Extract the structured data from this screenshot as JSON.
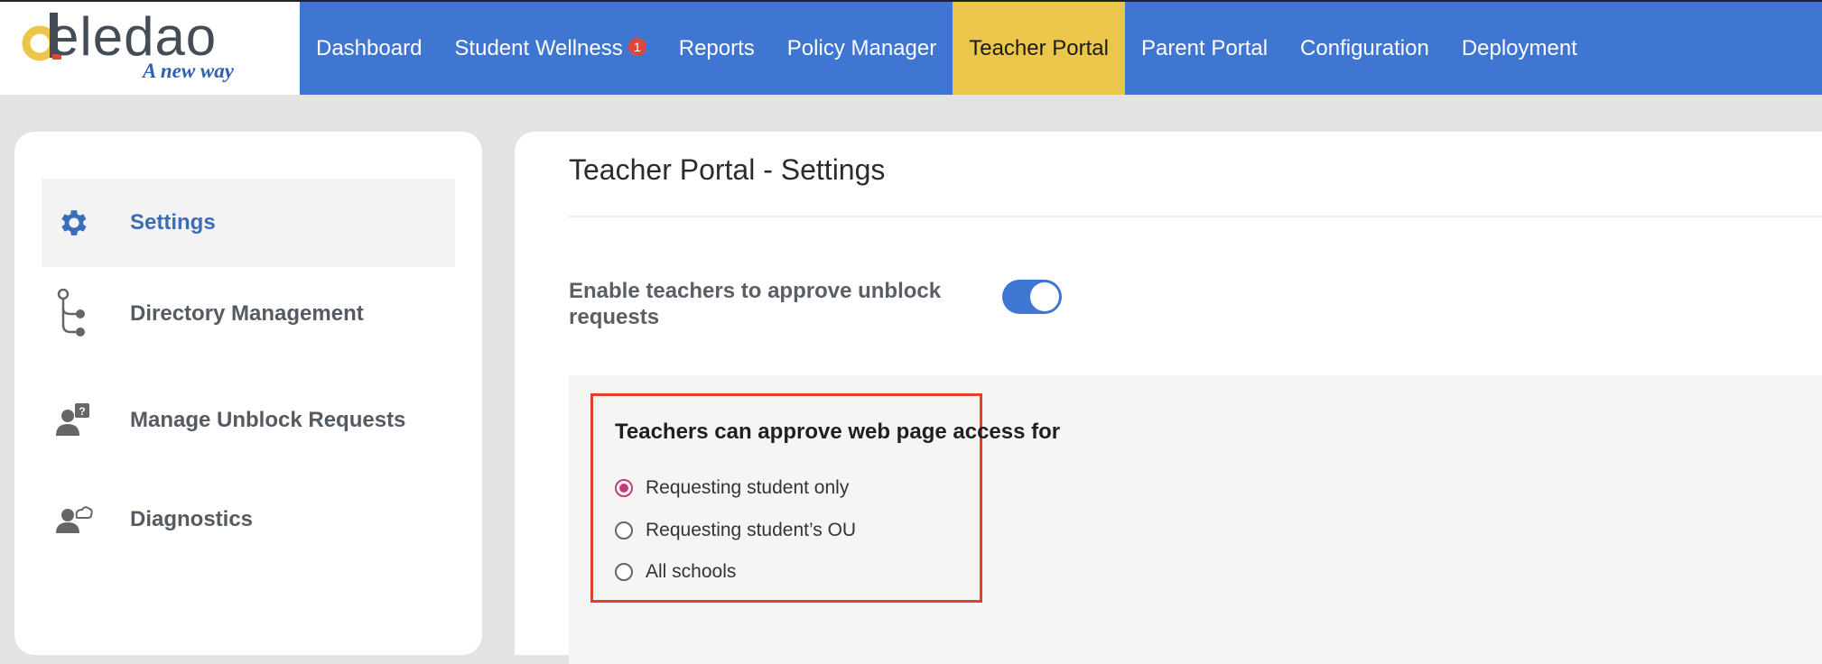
{
  "brand": {
    "name": "eledao",
    "tagline": "A new way"
  },
  "nav": {
    "items": [
      {
        "label": "Dashboard"
      },
      {
        "label": "Student Wellness",
        "badge": "1"
      },
      {
        "label": "Reports"
      },
      {
        "label": "Policy Manager"
      },
      {
        "label": "Teacher Portal",
        "active": true
      },
      {
        "label": "Parent Portal"
      },
      {
        "label": "Configuration"
      },
      {
        "label": "Deployment"
      }
    ]
  },
  "sidebar": {
    "items": [
      {
        "label": "Settings",
        "icon": "gear-icon",
        "active": true
      },
      {
        "label": "Directory Management",
        "icon": "tree-icon"
      },
      {
        "label": "Manage Unblock Requests",
        "icon": "user-question-icon"
      },
      {
        "label": "Diagnostics",
        "icon": "user-cloud-icon"
      }
    ]
  },
  "main": {
    "title": "Teacher Portal - Settings",
    "toggle": {
      "label": "Enable teachers to approve unblock requests",
      "enabled": true
    },
    "approval": {
      "title": "Teachers can approve web page access for",
      "options": [
        {
          "label": "Requesting student only",
          "selected": true
        },
        {
          "label": "Requesting student’s OU",
          "selected": false
        },
        {
          "label": "All schools",
          "selected": false
        }
      ]
    }
  },
  "colors": {
    "nav_bg": "#3f76d1",
    "nav_active": "#ecc64a",
    "highlight_border": "#e2402c",
    "radio_selected": "#c43d7a"
  }
}
